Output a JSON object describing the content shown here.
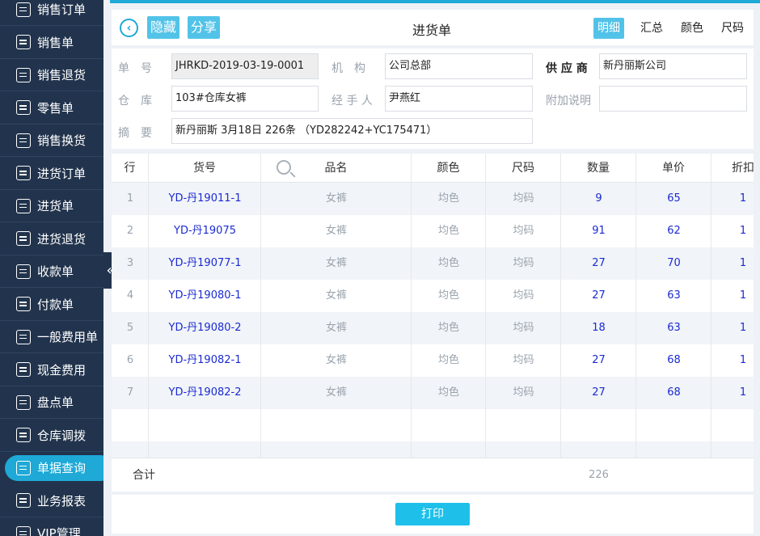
{
  "sidebar": {
    "items": [
      {
        "label": "销售订单",
        "icon": "doc-icon"
      },
      {
        "label": "销售单",
        "icon": "tag-icon"
      },
      {
        "label": "销售退货",
        "icon": "return-icon"
      },
      {
        "label": "零售单",
        "icon": "doc-icon"
      },
      {
        "label": "销售换货",
        "icon": "exchange-icon"
      },
      {
        "label": "进货订单",
        "icon": "doc-icon"
      },
      {
        "label": "进货单",
        "icon": "doc-icon"
      },
      {
        "label": "进货退货",
        "icon": "return-icon"
      },
      {
        "label": "收款单",
        "icon": "receipt-icon"
      },
      {
        "label": "付款单",
        "icon": "payment-icon"
      },
      {
        "label": "一般费用单",
        "icon": "yen-icon"
      },
      {
        "label": "现金费用",
        "icon": "cash-icon"
      },
      {
        "label": "盘点单",
        "icon": "stocktake-icon"
      },
      {
        "label": "仓库调拨",
        "icon": "transfer-icon"
      },
      {
        "label": "单据查询",
        "icon": "search-doc-icon",
        "active": true
      },
      {
        "label": "业务报表",
        "icon": "chart-icon"
      },
      {
        "label": "VIP管理",
        "icon": "vip-icon"
      }
    ],
    "collapse_glyph": "«"
  },
  "header": {
    "back_glyph": "‹",
    "hide_label": "隐藏",
    "share_label": "分享",
    "title": "进货单",
    "tabs": [
      "明细",
      "汇总",
      "颜色",
      "尺码"
    ],
    "active_tab": "明细"
  },
  "form": {
    "order_no_label": "单　号",
    "order_no": "JHRKD-2019-03-19-0001",
    "org_label": "机　构",
    "org": "公司总部",
    "supplier_label": "供 应 商",
    "supplier": "新丹丽斯公司",
    "warehouse_label": "仓　库",
    "warehouse": "103#仓库女裤",
    "handler_label": "经 手 人",
    "handler": "尹燕红",
    "note_label": "附加说明",
    "note": "",
    "summary_label": "摘　要",
    "summary": "新丹丽斯  3月18日  226条  （YD282242+YC175471）"
  },
  "table": {
    "headers": [
      "行",
      "货号",
      "品名",
      "颜色",
      "尺码",
      "数量",
      "单价",
      "折扣"
    ],
    "rows": [
      {
        "idx": "1",
        "code": "YD-丹19011-1",
        "name": "女裤",
        "color": "均色",
        "size": "均码",
        "qty": "9",
        "price": "65",
        "disc": "1"
      },
      {
        "idx": "2",
        "code": "YD-丹19075",
        "name": "女裤",
        "color": "均色",
        "size": "均码",
        "qty": "91",
        "price": "62",
        "disc": "1"
      },
      {
        "idx": "3",
        "code": "YD-丹19077-1",
        "name": "女裤",
        "color": "均色",
        "size": "均码",
        "qty": "27",
        "price": "70",
        "disc": "1"
      },
      {
        "idx": "4",
        "code": "YD-丹19080-1",
        "name": "女裤",
        "color": "均色",
        "size": "均码",
        "qty": "27",
        "price": "63",
        "disc": "1"
      },
      {
        "idx": "5",
        "code": "YD-丹19080-2",
        "name": "女裤",
        "color": "均色",
        "size": "均码",
        "qty": "18",
        "price": "63",
        "disc": "1"
      },
      {
        "idx": "6",
        "code": "YD-丹19082-1",
        "name": "女裤",
        "color": "均色",
        "size": "均码",
        "qty": "27",
        "price": "68",
        "disc": "1"
      },
      {
        "idx": "7",
        "code": "YD-丹19082-2",
        "name": "女裤",
        "color": "均色",
        "size": "均码",
        "qty": "27",
        "price": "68",
        "disc": "1"
      }
    ],
    "total_label": "合计",
    "total_qty": "226"
  },
  "footer": {
    "print_label": "打印"
  },
  "colors": {
    "sidebar_bg": "#22344d",
    "accent": "#1ea9d6",
    "button": "#52c3e8",
    "link_blue": "#1a2ad2"
  }
}
